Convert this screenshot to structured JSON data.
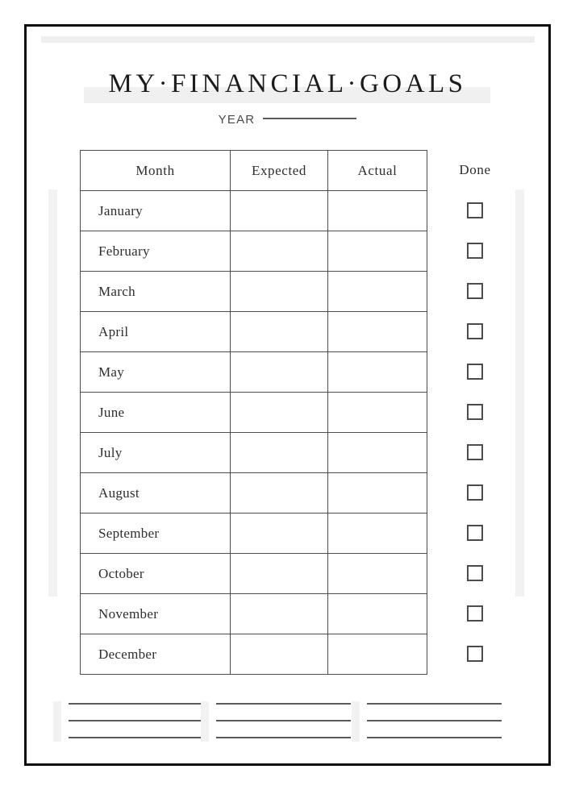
{
  "document": {
    "title": "MY·FINANCIAL·GOALS",
    "year_label": "YEAR",
    "year_value": ""
  },
  "table": {
    "headers": {
      "month": "Month",
      "expected": "Expected",
      "actual": "Actual",
      "done": "Done"
    },
    "rows": [
      {
        "month": "January",
        "expected": "",
        "actual": "",
        "done": false
      },
      {
        "month": "February",
        "expected": "",
        "actual": "",
        "done": false
      },
      {
        "month": "March",
        "expected": "",
        "actual": "",
        "done": false
      },
      {
        "month": "April",
        "expected": "",
        "actual": "",
        "done": false
      },
      {
        "month": "May",
        "expected": "",
        "actual": "",
        "done": false
      },
      {
        "month": "June",
        "expected": "",
        "actual": "",
        "done": false
      },
      {
        "month": "July",
        "expected": "",
        "actual": "",
        "done": false
      },
      {
        "month": "August",
        "expected": "",
        "actual": "",
        "done": false
      },
      {
        "month": "September",
        "expected": "",
        "actual": "",
        "done": false
      },
      {
        "month": "October",
        "expected": "",
        "actual": "",
        "done": false
      },
      {
        "month": "November",
        "expected": "",
        "actual": "",
        "done": false
      },
      {
        "month": "December",
        "expected": "",
        "actual": "",
        "done": false
      }
    ]
  },
  "notes": {
    "groups": [
      {
        "lines": [
          "",
          "",
          ""
        ]
      },
      {
        "lines": [
          "",
          "",
          ""
        ]
      },
      {
        "lines": [
          "",
          "",
          ""
        ]
      }
    ]
  },
  "colors": {
    "ink": "#1c1c1c",
    "rule": "#4c4c4c",
    "accent_grey": "#f0f0f0",
    "page": "#ffffff"
  }
}
